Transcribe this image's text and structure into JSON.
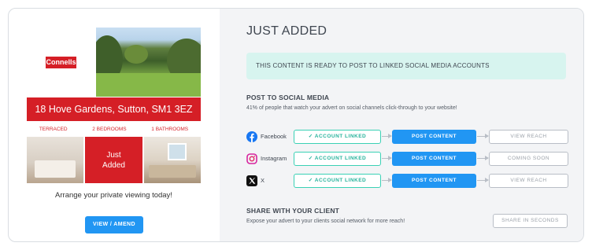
{
  "flyer": {
    "brand": "Connells",
    "address": "18 Hove Gardens, Sutton, SM1 3EZ",
    "features": [
      "TERRACED",
      "2 BEDROOMS",
      "1 BATHROOMS"
    ],
    "badge_line1": "Just",
    "badge_line2": "Added",
    "cta": "Arrange your private viewing today!"
  },
  "view_button": "VIEW / AMEND",
  "panel": {
    "title": "JUST ADDED",
    "ready_message": "THIS CONTENT IS READY TO POST TO LINKED SOCIAL MEDIA ACCOUNTS",
    "post_section": {
      "title": "POST TO SOCIAL MEDIA",
      "subtitle": "41% of people that watch your advert on social channels click-through to your website!"
    },
    "networks": [
      {
        "name": "Facebook",
        "icon": "facebook-icon",
        "linked": "✓ ACCOUNT LINKED",
        "post": "POST CONTENT",
        "action": "VIEW REACH"
      },
      {
        "name": "Instagram",
        "icon": "instagram-icon",
        "linked": "✓ ACCOUNT LINKED",
        "post": "POST CONTENT",
        "action": "COMING SOON"
      },
      {
        "name": "X",
        "icon": "x-icon",
        "linked": "✓ ACCOUNT LINKED",
        "post": "POST CONTENT",
        "action": "VIEW REACH"
      }
    ],
    "share_section": {
      "title": "SHARE WITH YOUR CLIENT",
      "subtitle": "Expose your advert to your clients social network for more reach!",
      "button": "SHARE IN SECONDS"
    }
  },
  "colors": {
    "brand_red": "#d51f26",
    "primary_blue": "#2196f3",
    "teal": "#3ad1b5",
    "panel_bg": "#f3f4f6",
    "ready_bg": "#d7f4ef"
  }
}
